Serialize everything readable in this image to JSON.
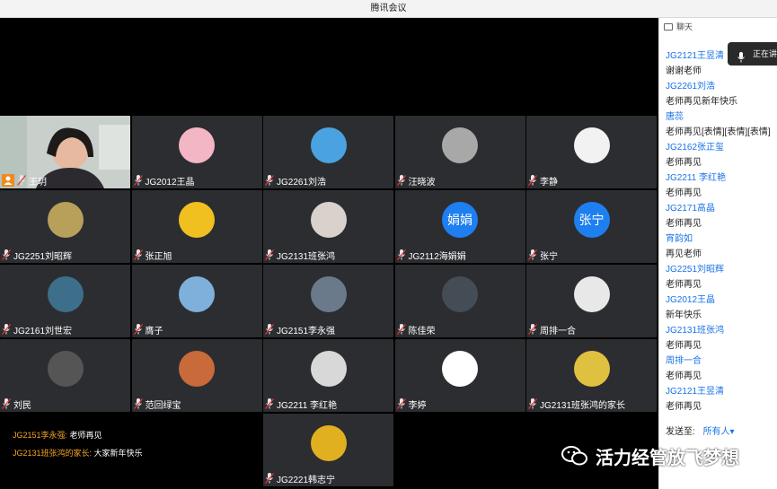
{
  "window": {
    "title": "腾讯会议"
  },
  "tiles": [
    {
      "name": "王玥",
      "row": 0,
      "col": 0,
      "type": "camera",
      "host": true
    },
    {
      "name": "JG2012王晶",
      "row": 0,
      "col": 1,
      "avatar_color": "#f2b6c4"
    },
    {
      "name": "JG2261刘浩",
      "row": 0,
      "col": 2,
      "avatar_color": "#4aa3e0"
    },
    {
      "name": "汪晓波",
      "row": 0,
      "col": 3,
      "avatar_color": "#a8a8a8"
    },
    {
      "name": "李静",
      "row": 0,
      "col": 4,
      "avatar_color": "#f2f2f2"
    },
    {
      "name": "JG2251刘昭辉",
      "row": 1,
      "col": 0,
      "avatar_color": "#b8a05a"
    },
    {
      "name": "张正旭",
      "row": 1,
      "col": 1,
      "avatar_color": "#f0c020"
    },
    {
      "name": "JG2131班张鸿",
      "row": 1,
      "col": 2,
      "avatar_color": "#d9d2cc"
    },
    {
      "name": "JG2112海娟娟",
      "row": 1,
      "col": 3,
      "avatar_text": "娟娟"
    },
    {
      "name": "张宁",
      "row": 1,
      "col": 4,
      "avatar_text": "张宁"
    },
    {
      "name": "JG2161刘世宏",
      "row": 2,
      "col": 0,
      "avatar_color": "#3d6e8a"
    },
    {
      "name": "膺子",
      "row": 2,
      "col": 1,
      "avatar_color": "#7fb0dc"
    },
    {
      "name": "JG2151李永强",
      "row": 2,
      "col": 2,
      "avatar_color": "#6b7a8a"
    },
    {
      "name": "陈佳荣",
      "row": 2,
      "col": 3,
      "avatar_color": "#444c55"
    },
    {
      "name": "周排一合",
      "row": 2,
      "col": 4,
      "avatar_color": "#e8e8e8"
    },
    {
      "name": "刘民",
      "row": 3,
      "col": 0,
      "avatar_color": "#555555"
    },
    {
      "name": "范回绿宝",
      "row": 3,
      "col": 1,
      "avatar_color": "#c86a3a"
    },
    {
      "name": "JG2211 李红艳",
      "row": 3,
      "col": 2,
      "avatar_color": "#d8d8d8"
    },
    {
      "name": "李婷",
      "row": 3,
      "col": 3,
      "avatar_color": "#ffffff"
    },
    {
      "name": "JG2131班张鸿的家长",
      "row": 3,
      "col": 4,
      "avatar_color": "#e0c040"
    },
    {
      "name": "JG2221韩志宁",
      "row": 4,
      "col": 2,
      "avatar_color": "#e0b020"
    }
  ],
  "overlay_chat": [
    {
      "sender": "JG2151李永强:",
      "msg": "老师再见"
    },
    {
      "sender": "JG2131班张鸿的家长:",
      "msg": "大家新年快乐"
    }
  ],
  "chat_panel": {
    "title": "聊天",
    "speaking": "正在讲",
    "messages": [
      {
        "name": "JG2121王昱清",
        "text": "谢谢老师"
      },
      {
        "name": "JG2261刘浩",
        "text": "老师再见新年快乐"
      },
      {
        "name": "唐蕊",
        "text": "老师再见[表情][表情][表情]"
      },
      {
        "name": "JG2162张正玺",
        "text": "老师再见"
      },
      {
        "name": "JG2211  李红艳",
        "text": "老师再见"
      },
      {
        "name": "JG2171高晶",
        "text": "老师再见"
      },
      {
        "name": "宵韵如",
        "text": "再见老师"
      },
      {
        "name": "JG2251刘昭辉",
        "text": "老师再见"
      },
      {
        "name": "JG2012王晶",
        "text": "新年快乐"
      },
      {
        "name": "JG2131班张鸿",
        "text": "老师再见"
      },
      {
        "name": "周排一合",
        "text": "老师再见"
      },
      {
        "name": "JG2121王昱清",
        "text": "老师再见"
      }
    ],
    "send_to_label": "发送至:",
    "send_to_target": "所有人▾"
  },
  "watermark": {
    "text": "活力经管放飞梦想"
  },
  "colors": {
    "tile_bg": "#2c2d31",
    "accent": "#1a73e8",
    "overlay_sender": "#f5a623"
  }
}
